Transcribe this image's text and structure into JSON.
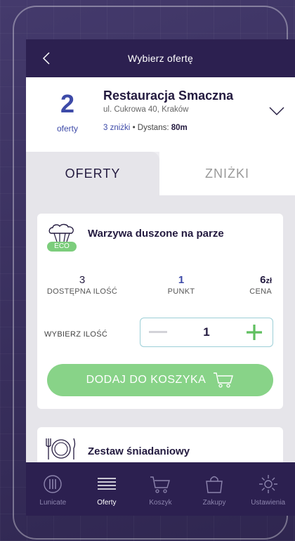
{
  "header": {
    "title": "Wybierz ofertę",
    "back_icon": "chevron-left-icon"
  },
  "restaurant": {
    "count": "2",
    "count_label": "oferty",
    "name": "Restauracja Smaczna",
    "address": "ul. Cukrowa 40, Kraków",
    "discounts": "3 zniżki",
    "separator": "•",
    "distance_label": "Dystans:",
    "distance_value": "80m",
    "expand_icon": "chevron-down-icon"
  },
  "tabs": [
    {
      "label": "OFERTY",
      "active": true
    },
    {
      "label": "ZNIŻKI",
      "active": false
    }
  ],
  "offers": [
    {
      "name": "Warzywa duszone na parze",
      "badge": "ECO",
      "icon": "broccoli-icon",
      "available_qty": "3",
      "available_label": "DOSTĘPNA ILOŚĆ",
      "points": "1",
      "points_label": "PUNKT",
      "price_value": "6",
      "price_unit": "zł",
      "price_label": "CENA",
      "qty_label": "WYBIERZ ILOŚĆ",
      "qty_value": "1",
      "add_button": "DODAJ DO KOSZYKA"
    },
    {
      "name": "Zestaw śniadaniowy",
      "icon": "plate-cutlery-icon"
    }
  ],
  "nav": [
    {
      "label": "Lunicate",
      "icon": "lunicate-logo-icon",
      "active": false
    },
    {
      "label": "Oferty",
      "icon": "list-icon",
      "active": true
    },
    {
      "label": "Koszyk",
      "icon": "cart-icon",
      "active": false
    },
    {
      "label": "Zakupy",
      "icon": "shopping-bag-icon",
      "active": false
    },
    {
      "label": "Ustawienia",
      "icon": "gear-icon",
      "active": false
    }
  ],
  "colors": {
    "accent": "#3d4aa8",
    "dark": "#2c2050",
    "green": "#88d388",
    "eco": "#7ccd7c"
  }
}
